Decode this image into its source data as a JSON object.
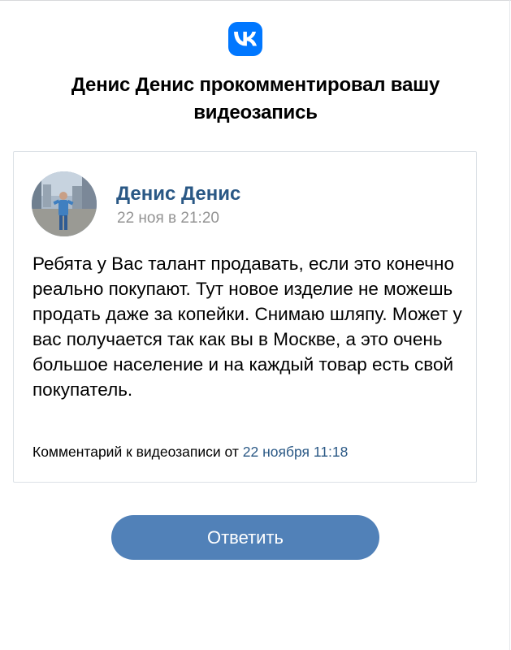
{
  "brand": {
    "logo_icon": "vk-logo-icon",
    "logo_color": "#0077FF"
  },
  "notification": {
    "headline": "Денис Денис прокомментировал вашу видеозапись"
  },
  "comment": {
    "author_name": "Денис Денис",
    "post_date": "22 ноя в 21:20",
    "text": "Ребята у Вас талант продавать, если это конечно реально покупают. Тут новое изделие не можешь продать даже за копейки. Снимаю шляпу. Может у вас получается так как вы в Москве, а это очень большое население и на каждый товар есть свой покупатель.",
    "footer_prefix": "Комментарий к видеозаписи от ",
    "footer_date": "22 ноября 11:18",
    "link_color": "#2A5885"
  },
  "actions": {
    "reply_label": "Ответить",
    "reply_color": "#5181B8"
  }
}
